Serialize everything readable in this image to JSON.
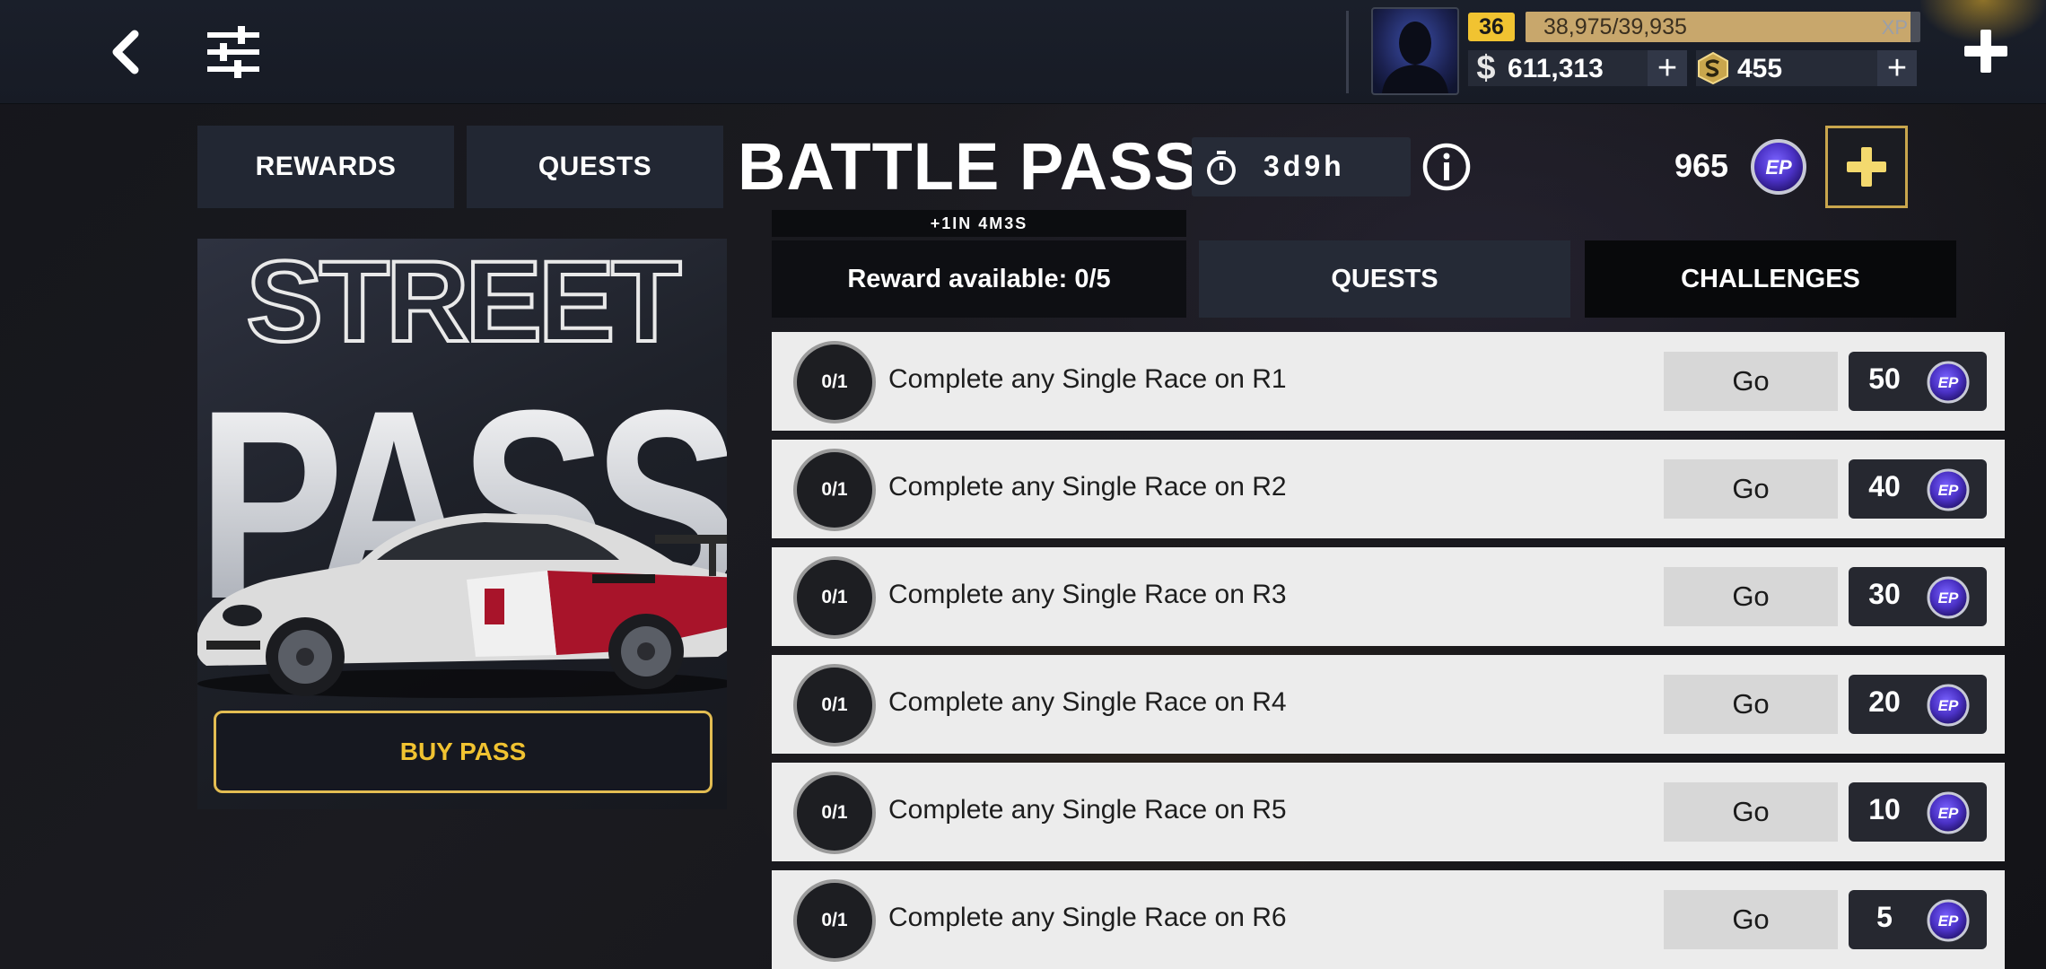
{
  "topbar": {
    "level": "36",
    "xp_text": "38,975/39,935",
    "xp_label": "XP",
    "xp_progress": 0.976,
    "cash": "611,313",
    "gold": "455",
    "plus": "+"
  },
  "header": {
    "tab_rewards": "REWARDS",
    "tab_quests": "QUESTS",
    "title": "BATTLE PASS",
    "timer": "3d9h",
    "ep_total": "965",
    "refresh_text": "+1IN  4M3S"
  },
  "promo": {
    "title_top": "STREET",
    "title_bottom": "PASS",
    "buy_label": "BUY PASS"
  },
  "subtabs": {
    "available": "Reward available: 0/5",
    "quests": "QUESTS",
    "challenges": "CHALLENGES"
  },
  "quests": [
    {
      "progress": "0/1",
      "text": "Complete any Single Race on R1",
      "go": "Go",
      "reward": "50"
    },
    {
      "progress": "0/1",
      "text": "Complete any Single Race on R2",
      "go": "Go",
      "reward": "40"
    },
    {
      "progress": "0/1",
      "text": "Complete any Single Race on R3",
      "go": "Go",
      "reward": "30"
    },
    {
      "progress": "0/1",
      "text": "Complete any Single Race on R4",
      "go": "Go",
      "reward": "20"
    },
    {
      "progress": "0/1",
      "text": "Complete any Single Race on R5",
      "go": "Go",
      "reward": "10"
    },
    {
      "progress": "0/1",
      "text": "Complete any Single Race on R6",
      "go": "Go",
      "reward": "5"
    }
  ],
  "colors": {
    "accent_gold": "#f1c331",
    "ep_purple": "#5b3fd6",
    "row_bg": "#ececec"
  },
  "icons": {
    "back": "chevron-left-icon",
    "settings": "sliders-icon",
    "timer": "stopwatch-icon",
    "info": "info-icon",
    "ep": "ep-coin-icon",
    "gold": "gold-coin-icon"
  }
}
